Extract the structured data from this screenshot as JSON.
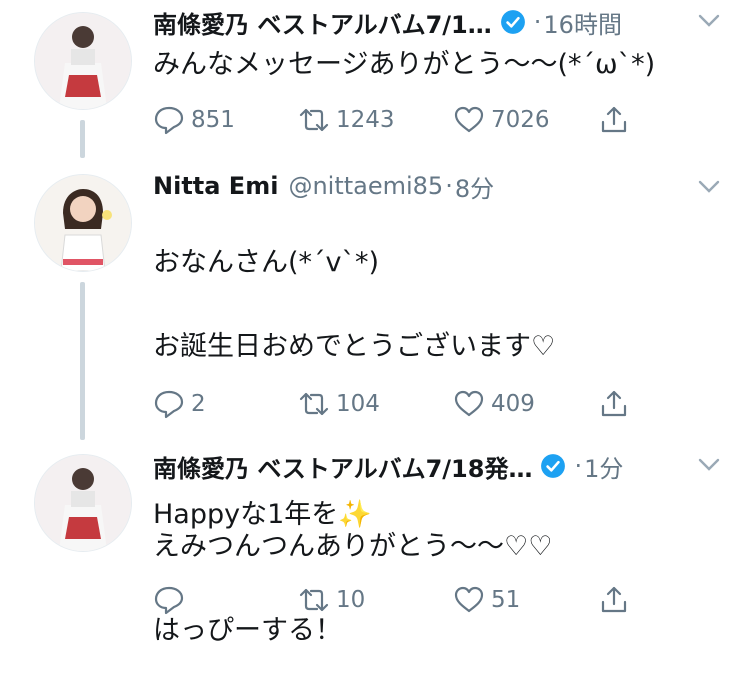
{
  "tweets": [
    {
      "name": "南條愛乃 ベストアルバム7/1…",
      "verified": true,
      "time": "16時間",
      "text": "みんなメッセージありがとう〜〜(*´ω`*)",
      "replies": "851",
      "retweets": "1243",
      "likes": "7026",
      "avatar_icon": "avatar-nanjo-icon"
    },
    {
      "name": "Nitta Emi",
      "handle": "@nittaemi85",
      "time": "8分",
      "text_line1": "おなんさん(*´v`*)",
      "text_line2": "お誕生日おめでとうございます♡",
      "text_line3": "Happyな1年を✨",
      "replies": "2",
      "retweets": "104",
      "likes": "409",
      "avatar_icon": "avatar-nitta-icon"
    },
    {
      "name": "南條愛乃 ベストアルバム7/18発…",
      "verified": true,
      "time": "1分",
      "text_line1": "えみつんつんありがとう〜〜♡♡",
      "text_line2": "はっぴーする！",
      "replies": "",
      "retweets": "10",
      "likes": "51",
      "avatar_icon": "avatar-nanjo-icon"
    }
  ],
  "colors": {
    "text": "#14171a",
    "secondary": "#657786",
    "verified": "#1da1f2",
    "thread_line": "#ccd6dd"
  }
}
